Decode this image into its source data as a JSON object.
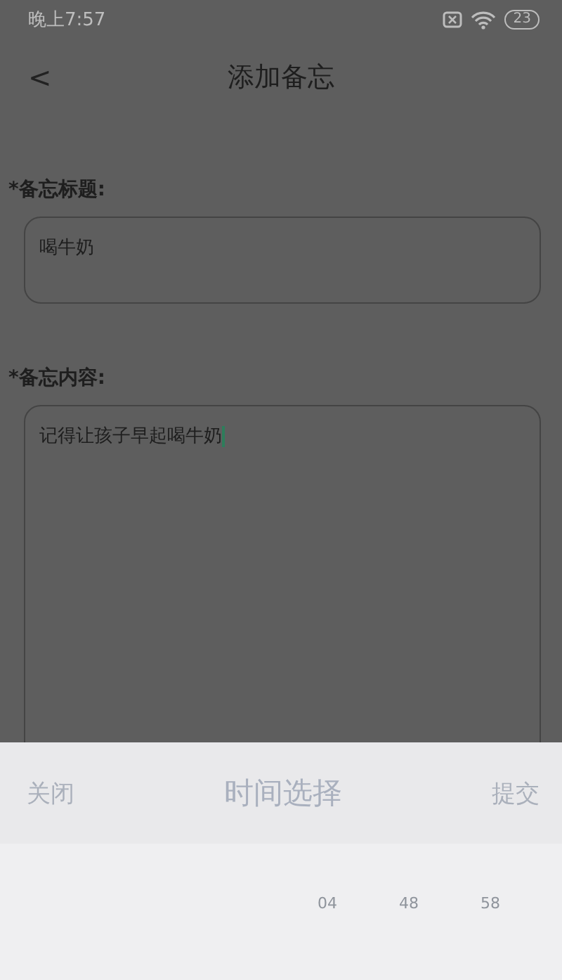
{
  "status_bar": {
    "time": "晚上7:57",
    "battery": "23"
  },
  "header": {
    "back": "<",
    "title": "添加备忘"
  },
  "form": {
    "fields": [
      {
        "label": "*备忘标题:",
        "value": "喝牛奶",
        "kind": "single"
      },
      {
        "label": "*备忘内容:",
        "value": "记得让孩子早起喝牛奶",
        "kind": "multi"
      }
    ]
  },
  "time_picker": {
    "close": "关闭",
    "title": "时间选择",
    "submit": "提交",
    "columns": [
      {
        "item": "04"
      },
      {
        "item": "48"
      },
      {
        "item": "58"
      }
    ]
  }
}
